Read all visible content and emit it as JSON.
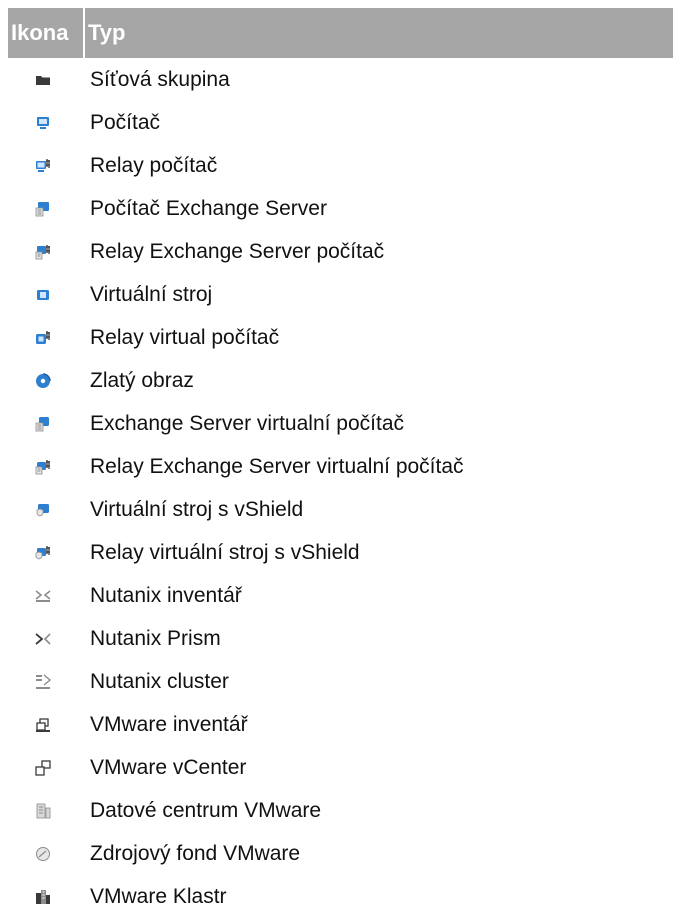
{
  "table": {
    "headers": {
      "icon": "Ikona",
      "type": "Typ"
    },
    "rows": [
      {
        "icon": "folder-icon",
        "label": "Síťová skupina"
      },
      {
        "icon": "computer-icon",
        "label": "Počítač"
      },
      {
        "icon": "relay-computer-icon",
        "label": "Relay počítač"
      },
      {
        "icon": "exchange-computer-icon",
        "label": "Počítač Exchange Server"
      },
      {
        "icon": "relay-exchange-computer-icon",
        "label": "Relay Exchange Server počítač"
      },
      {
        "icon": "virtual-machine-icon",
        "label": "Virtuální stroj"
      },
      {
        "icon": "relay-virtual-machine-icon",
        "label": "Relay virtual počítač"
      },
      {
        "icon": "golden-image-icon",
        "label": "Zlatý obraz"
      },
      {
        "icon": "exchange-virtual-computer-icon",
        "label": "Exchange Server virtualní počítač"
      },
      {
        "icon": "relay-exchange-virtual-computer-icon",
        "label": "Relay Exchange Server virtualní počítač"
      },
      {
        "icon": "vshield-virtual-machine-icon",
        "label": "Virtuální stroj s vShield"
      },
      {
        "icon": "relay-vshield-virtual-machine-icon",
        "label": "Relay virtuální stroj s vShield"
      },
      {
        "icon": "nutanix-inventory-icon",
        "label": "Nutanix inventář"
      },
      {
        "icon": "nutanix-prism-icon",
        "label": "Nutanix Prism"
      },
      {
        "icon": "nutanix-cluster-icon",
        "label": "Nutanix cluster"
      },
      {
        "icon": "vmware-inventory-icon",
        "label": "VMware inventář"
      },
      {
        "icon": "vmware-vcenter-icon",
        "label": "VMware vCenter"
      },
      {
        "icon": "vmware-datacenter-icon",
        "label": "Datové centrum VMware"
      },
      {
        "icon": "vmware-resource-pool-icon",
        "label": "Zdrojový fond VMware"
      },
      {
        "icon": "vmware-cluster-icon",
        "label": "VMware Klastr"
      }
    ]
  },
  "colors": {
    "header_bg": "#a6a6a6",
    "header_text": "#ffffff",
    "icon_blue": "#2f7fd1",
    "icon_dark": "#3a3a3a",
    "icon_gray": "#8c8c8c"
  }
}
